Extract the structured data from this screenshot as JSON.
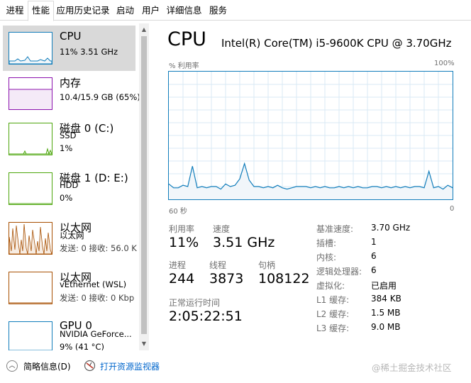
{
  "tabs": [
    {
      "label": "进程"
    },
    {
      "label": "性能"
    },
    {
      "label": "应用历史记录"
    },
    {
      "label": "启动"
    },
    {
      "label": "用户"
    },
    {
      "label": "详细信息"
    },
    {
      "label": "服务"
    }
  ],
  "active_tab": "性能",
  "sidebar": {
    "items": [
      {
        "title": "CPU",
        "lines": [
          "11%  3.51 GHz"
        ],
        "color": "#117dbb",
        "selected": true
      },
      {
        "title": "内存",
        "lines": [
          "10.4/15.9 GB (65%)"
        ],
        "color": "#8b12ae",
        "selected": false
      },
      {
        "title": "磁盘 0 (C:)",
        "lines": [
          "SSD",
          "1%"
        ],
        "color": "#4da60c",
        "selected": false
      },
      {
        "title": "磁盘 1 (D: E:)",
        "lines": [
          "HDD",
          "0%"
        ],
        "color": "#4da60c",
        "selected": false
      },
      {
        "title": "以太网",
        "lines": [
          "以太网",
          "发送: 0  接收: 56.0 K"
        ],
        "color": "#a74f01",
        "selected": false
      },
      {
        "title": "以太网",
        "lines": [
          "vEthernet (WSL)",
          "发送: 0  接收: 0 Kbp"
        ],
        "color": "#a74f01",
        "selected": false
      },
      {
        "title": "GPU 0",
        "lines": [
          "NVIDIA GeForce...",
          "9%  (41 °C)"
        ],
        "color": "#117dbb",
        "selected": false
      }
    ]
  },
  "main": {
    "title": "CPU",
    "subtitle": "Intel(R) Core(TM) i5-9600K CPU @ 3.70GHz",
    "graph": {
      "top_left": "% 利用率",
      "top_right": "100%",
      "bottom_left": "60 秒",
      "bottom_right": "0",
      "line_color": "#117dbb",
      "fill_color": "#f1f6fa",
      "grid_color": "#d9eaf4",
      "utilization_percent": [
        12,
        9,
        9,
        11,
        10,
        26,
        9,
        10,
        9,
        10,
        10,
        8,
        12,
        10,
        11,
        16,
        28,
        15,
        10,
        10,
        9,
        10,
        9,
        11,
        9,
        8,
        9,
        10,
        10,
        10,
        9,
        10,
        9,
        10,
        9,
        9,
        10,
        9,
        10,
        9,
        10,
        9,
        9,
        10,
        10,
        9,
        10,
        9,
        10,
        9,
        10,
        9,
        10,
        10,
        9,
        22,
        9,
        10,
        8,
        11,
        9
      ]
    },
    "stats": {
      "utilization_label": "利用率",
      "utilization": "11%",
      "speed_label": "速度",
      "speed": "3.51 GHz",
      "processes_label": "进程",
      "processes": "244",
      "threads_label": "线程",
      "threads": "3873",
      "handles_label": "句柄",
      "handles": "108122",
      "uptime_label": "正常运行时间",
      "uptime": "2:05:22:51"
    },
    "info": [
      {
        "label": "基准速度:",
        "value": "3.70 GHz"
      },
      {
        "label": "插槽:",
        "value": "1"
      },
      {
        "label": "内核:",
        "value": "6"
      },
      {
        "label": "逻辑处理器:",
        "value": "6"
      },
      {
        "label": "虚拟化:",
        "value": "已启用"
      },
      {
        "label": "L1 缓存:",
        "value": "384 KB"
      },
      {
        "label": "L2 缓存:",
        "value": "1.5 MB"
      },
      {
        "label": "L3 缓存:",
        "value": "9.0 MB"
      }
    ]
  },
  "footer": {
    "fewer_details": "简略信息(D)",
    "open_monitor": "打开资源监视器",
    "watermark": "@稀土掘金技术社区"
  }
}
